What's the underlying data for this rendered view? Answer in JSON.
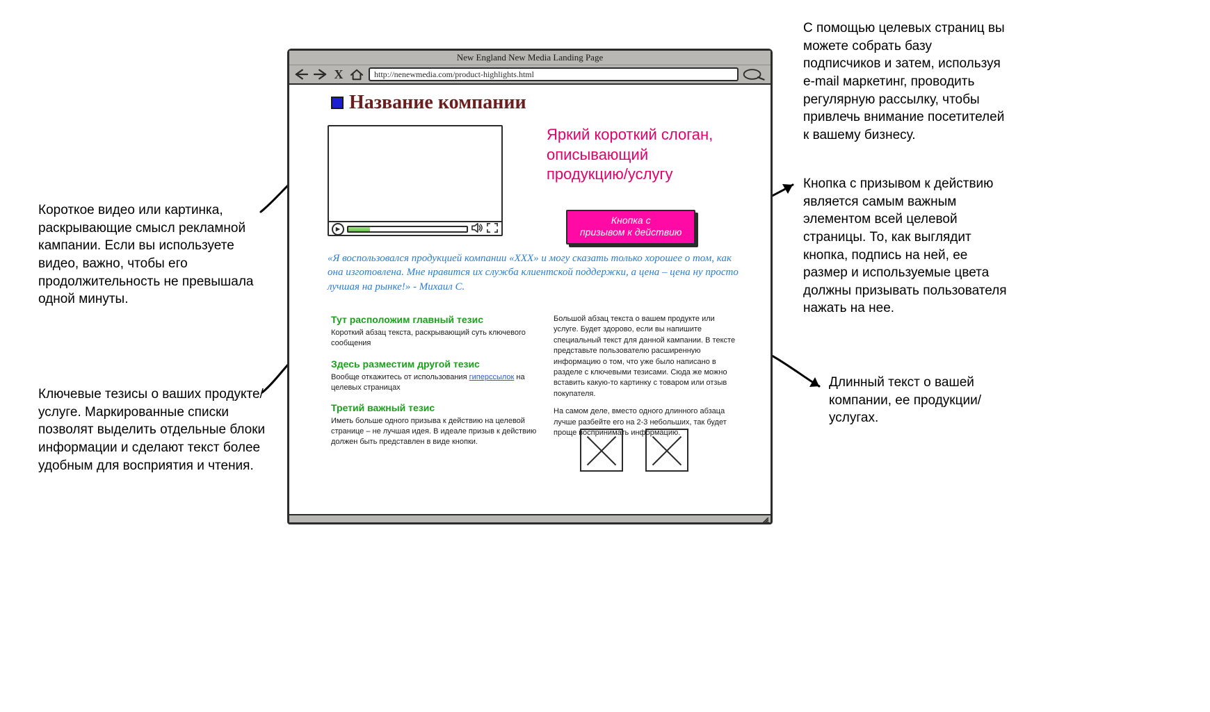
{
  "browser": {
    "title": "New England New Media Landing Page",
    "url": "http://nenewmedia.com/product-highlights.html"
  },
  "header": {
    "company_name": "Название компании"
  },
  "hero": {
    "slogan": "Яркий короткий слоган, описывающий продукцию/услугу",
    "cta_line1": "Кнопка с",
    "cta_line2": "призывом к действию"
  },
  "quote": "«Я воспользовался продукцией компании «XXX» и могу сказать только хорошее о том, как она изготовлена. Мне нравится их служба клиентской поддержки, а цена – цена ну просто лучшая на рынке!» - Михаил С.",
  "theses": [
    {
      "title": "Тут расположим главный тезис",
      "body_pre": "Короткий абзац текста, раскрывающий суть ключевого сообщения",
      "link": "",
      "body_post": ""
    },
    {
      "title": "Здесь разместим другой тезис",
      "body_pre": "Вообще откажитесь от использования ",
      "link": "гиперссылок",
      "body_post": " на целевых страницах"
    },
    {
      "title": "Третий важный тезис",
      "body_pre": "Иметь больше одного призыва к действию на целевой странице – не лучшая идея. В идеале призыв к действию должен быть представлен в виде кнопки.",
      "link": "",
      "body_post": ""
    }
  ],
  "longtext": {
    "p1": "Большой абзац текста о вашем продукте или услуге. Будет здорово, если вы напишите специальный текст для данной кампании. В тексте представьте пользователю расширенную информацию о том, что уже было написано в разделе с ключевыми тезисами. Сюда же можно вставить какую-то картинку с товаром или отзыв покупателя.",
    "p2": "На самом деле, вместо одного длинного абзаца лучше разбейте его на 2-3 небольших, так будет проще воспринимать информацию."
  },
  "annotations": {
    "top_right": "С помощью целевых страниц вы можете собрать базу подписчиков и затем, используя e-mail маркетинг, проводить регулярную рассылку, чтобы привлечь внимание посетителей к вашему бизнесу.",
    "video": "Короткое видео или картинка, раскрывающие смысл рекламной кампании. Если вы используете видео, важно, чтобы его продолжительность не превышала одной минуты.",
    "cta": "Кнопка с призывом к действию является самым важным элементом всей целевой страницы. То, как выглядит кнопка, подпись на ней, ее размер и используемые цвета должны призывать пользователя нажать на нее.",
    "theses": "Ключевые тезисы о ваших продукте/услуге. Маркированные списки позволят выделить отдельные блоки информации и сделают текст более удобным для восприятия и чтения.",
    "longtext": "Длинный текст о вашей компании, ее продукции/услугах."
  }
}
